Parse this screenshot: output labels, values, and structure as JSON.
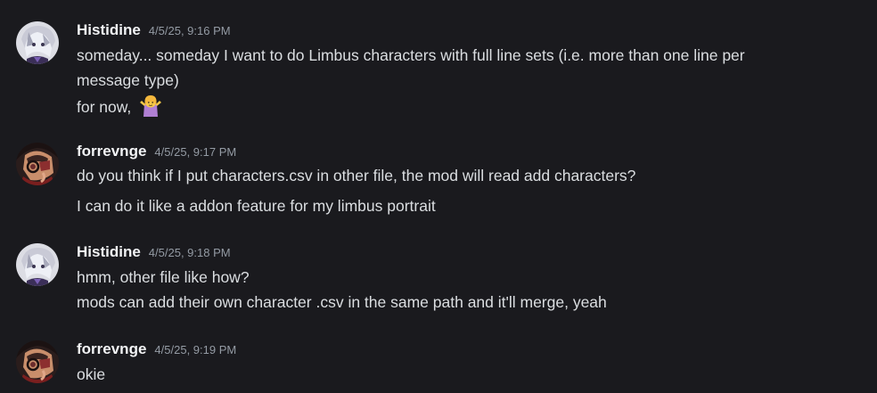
{
  "messages": [
    {
      "username": "Histidine",
      "timestamp": "4/5/25, 9:16 PM",
      "lines": [
        "someday... someday I want to do Limbus characters with full line sets (i.e. more than one line per",
        "message type)",
        "for now,"
      ],
      "emoji": "person-shrugging-emoji"
    },
    {
      "username": "forrevnge",
      "timestamp": "4/5/25, 9:17 PM",
      "lines": [
        "do you think if I put characters.csv in other file, the mod will read add characters?",
        "I can do it like a addon feature for my limbus portrait"
      ]
    },
    {
      "username": "Histidine",
      "timestamp": "4/5/25, 9:18 PM",
      "lines": [
        "hmm, other file like how?",
        "mods can add their own character .csv in the same path and it'll merge, yeah"
      ]
    },
    {
      "username": "forrevnge",
      "timestamp": "4/5/25, 9:19 PM",
      "lines": [
        "okie"
      ]
    }
  ],
  "colors": {
    "background": "#1a1a1e",
    "username": "#f2f3f5",
    "timestamp": "#949ba4",
    "text": "#dbdee1"
  }
}
